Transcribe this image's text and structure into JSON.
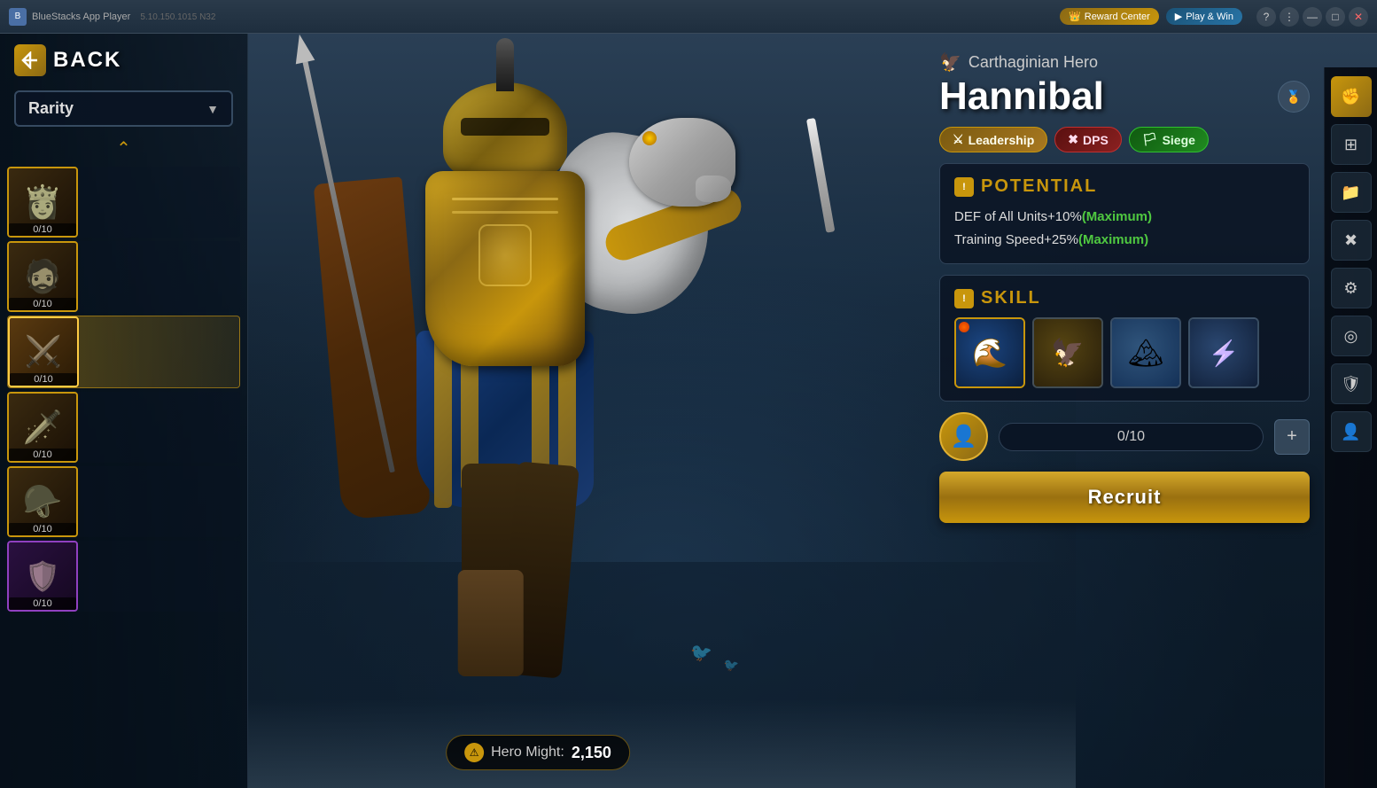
{
  "titlebar": {
    "app_name": "BlueStacks App Player",
    "version": "5.10.150.1015  N32",
    "reward_center": "Reward Center",
    "play_win": "Play & Win",
    "nav_back": "←",
    "nav_home": "⌂",
    "nav_screen": "⊡",
    "minimize": "—",
    "maximize": "□",
    "close": "✕",
    "question_icon": "?",
    "kebab_icon": "⋮"
  },
  "left_panel": {
    "back_label": "BACK",
    "rarity_label": "Rarity",
    "dropdown_arrow": "▼",
    "scroll_up": "˅",
    "heroes": [
      {
        "id": 1,
        "count": "0/10",
        "active": false
      },
      {
        "id": 2,
        "count": "0/10",
        "active": false
      },
      {
        "id": 3,
        "count": "0/10",
        "active": true
      },
      {
        "id": 4,
        "count": "0/10",
        "active": false
      },
      {
        "id": 5,
        "count": "0/10",
        "active": false
      },
      {
        "id": 6,
        "count": "0/10",
        "active": false,
        "rare": true
      }
    ]
  },
  "hero": {
    "subtitle_icon": "🦅",
    "subtitle": "Carthaginian Hero",
    "name": "Hannibal",
    "roles": [
      {
        "id": "leadership",
        "label": "Leadership",
        "icon": "⚔"
      },
      {
        "id": "dps",
        "label": "DPS",
        "icon": "✖"
      },
      {
        "id": "siege",
        "label": "Siege",
        "icon": "🏳"
      }
    ]
  },
  "potential": {
    "section_label": "POTENTIAL",
    "line1_prefix": "DEF of All Units+10%",
    "line1_suffix": "(Maximum)",
    "line2_prefix": "Training Speed+25%",
    "line2_suffix": "(Maximum)"
  },
  "skill": {
    "section_label": "SKILL",
    "fire_dot": true,
    "slots": [
      {
        "id": 1,
        "icon": "🌊",
        "active": true
      },
      {
        "id": 2,
        "icon": "🦅",
        "active": false
      },
      {
        "id": 3,
        "icon": "❄",
        "active": false
      },
      {
        "id": 4,
        "icon": "⚡",
        "active": false
      }
    ]
  },
  "recruit": {
    "progress": "0/10",
    "add_icon": "+",
    "button_label": "Recruit"
  },
  "bottom": {
    "might_label": "Hero Might:",
    "might_value": "2,150",
    "warning_icon": "⚠"
  },
  "right_sidebar": {
    "icons": [
      {
        "id": "fist",
        "symbol": "✊",
        "active": true
      },
      {
        "id": "grid",
        "symbol": "⊞",
        "active": false
      },
      {
        "id": "folder",
        "symbol": "📁",
        "active": false
      },
      {
        "id": "tools",
        "symbol": "⚙",
        "active": false
      },
      {
        "id": "cross",
        "symbol": "✛",
        "active": false
      },
      {
        "id": "shield",
        "symbol": "🛡",
        "active": false
      },
      {
        "id": "person",
        "symbol": "👤",
        "active": false
      },
      {
        "id": "settings",
        "symbol": "☰",
        "active": false
      }
    ]
  },
  "colors": {
    "gold": "#c8960c",
    "dark_bg": "#0a1520",
    "panel_bg": "rgba(10,20,35,0.85)",
    "green_highlight": "#4fc840",
    "accent_border": "rgba(100,130,160,0.4)"
  }
}
